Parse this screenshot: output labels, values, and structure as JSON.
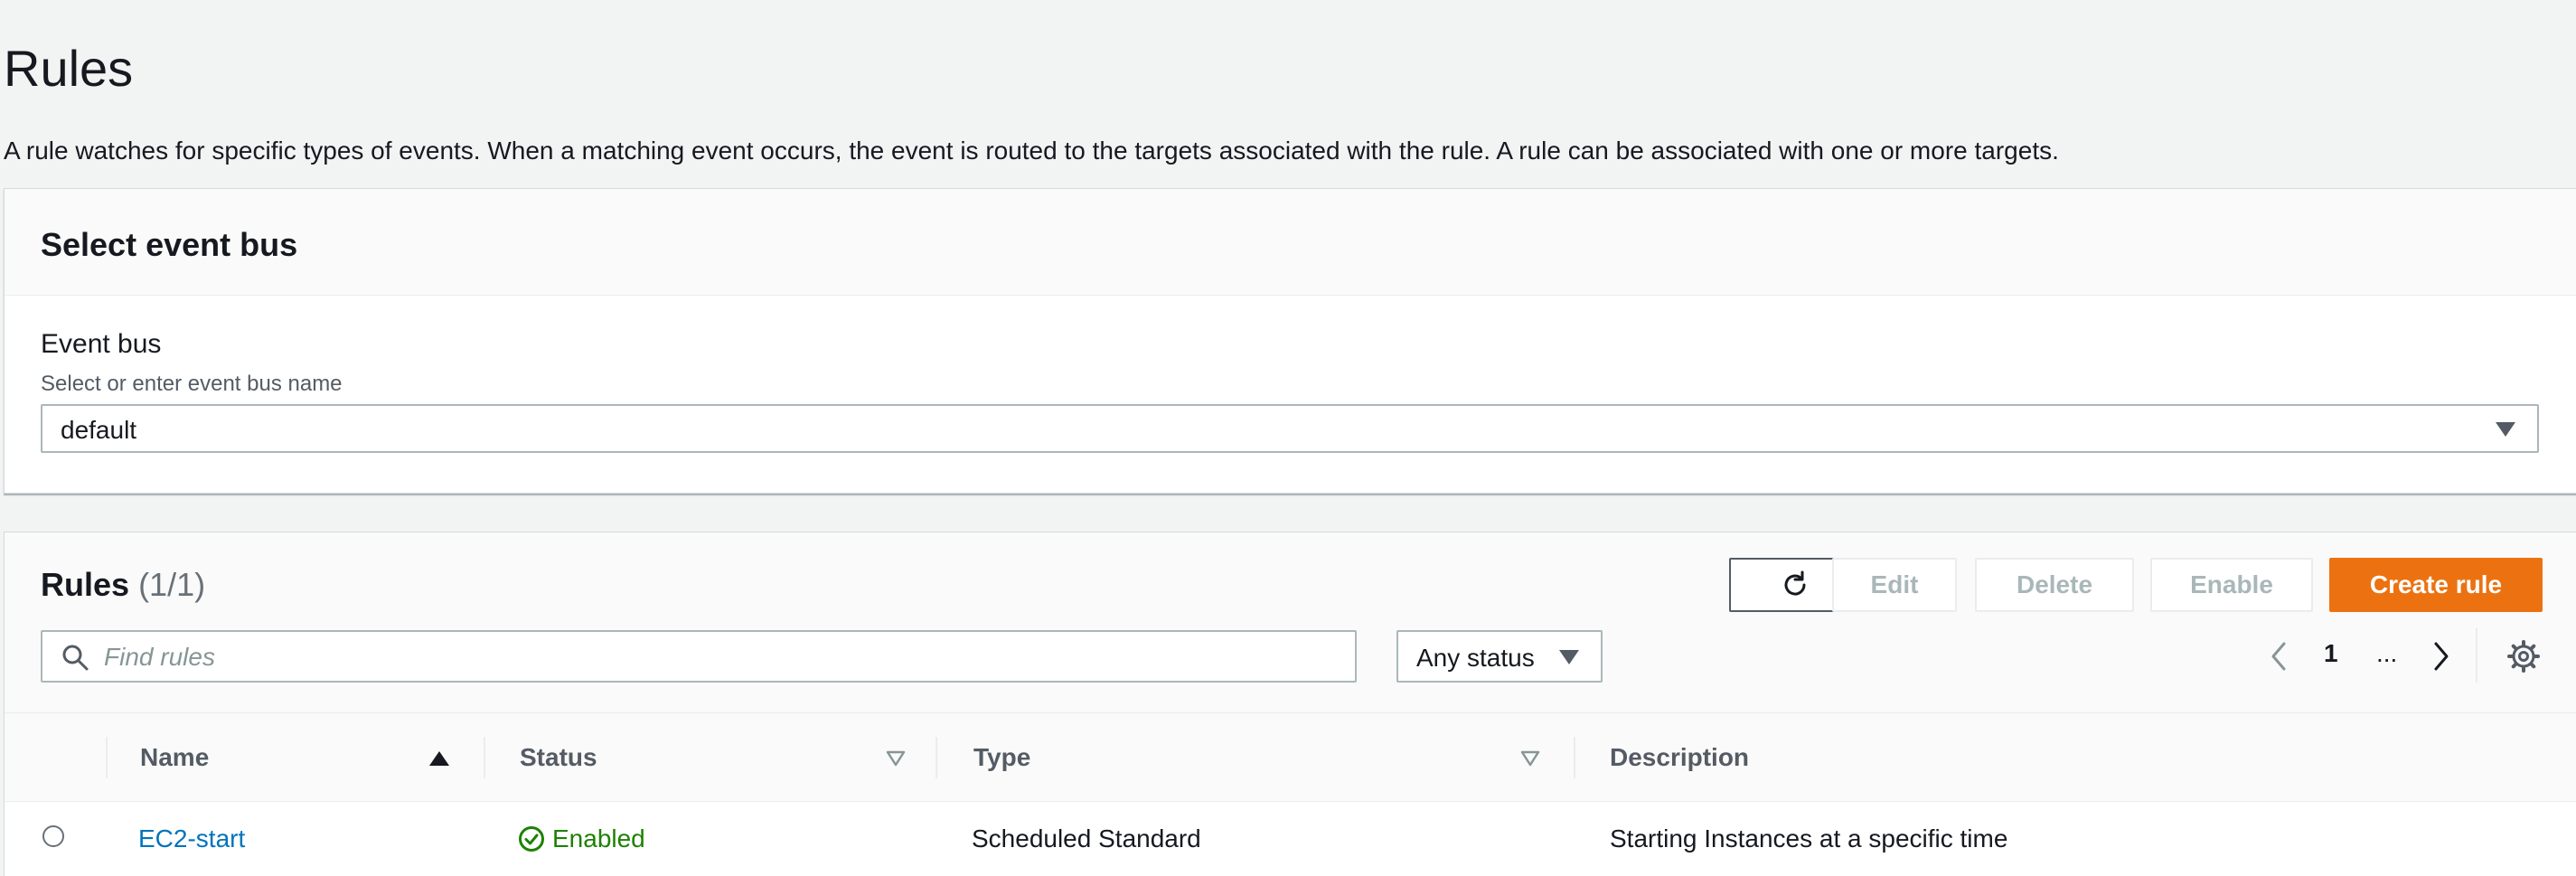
{
  "page": {
    "title": "Rules",
    "description": "A rule watches for specific types of events. When a matching event occurs, the event is routed to the targets associated with the rule. A rule can be associated with one or more targets."
  },
  "event_bus_panel": {
    "header": "Select event bus",
    "label": "Event bus",
    "hint": "Select or enter event bus name",
    "selected": "default"
  },
  "rules_panel": {
    "title": "Rules",
    "count": "(1/1)",
    "buttons": {
      "edit": "Edit",
      "delete": "Delete",
      "enable": "Enable",
      "create": "Create rule"
    },
    "search": {
      "placeholder": "Find rules",
      "value": ""
    },
    "status_filter": "Any status",
    "pagination": {
      "current_page": "1",
      "ellipsis": "..."
    },
    "columns": [
      "Name",
      "Status",
      "Type",
      "Description"
    ],
    "rows": [
      {
        "name": "EC2-start",
        "status": "Enabled",
        "type": "Scheduled Standard",
        "description": "Starting Instances at a specific time"
      }
    ]
  },
  "colors": {
    "primary_button": "#ec7211",
    "link": "#0073bb",
    "status_enabled": "#1d8102",
    "background": "#f2f3f3"
  },
  "icons": [
    "refresh-icon",
    "search-icon",
    "caret-down-icon",
    "chevron-left-icon",
    "chevron-right-icon",
    "gear-icon",
    "sort-ascending-icon",
    "sort-icon",
    "status-success-icon"
  ]
}
